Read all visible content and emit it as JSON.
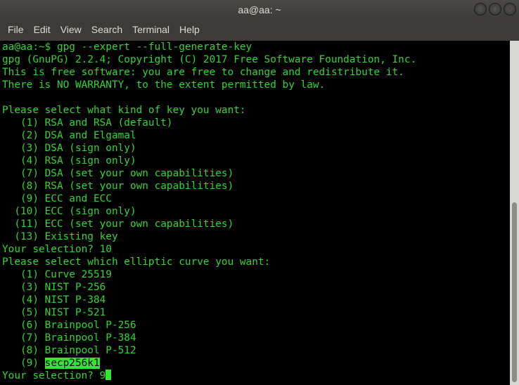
{
  "window": {
    "title": "aa@aa: ~"
  },
  "menu": [
    "File",
    "Edit",
    "View",
    "Search",
    "Terminal",
    "Help"
  ],
  "terminal": {
    "lines": [
      "aa@aa:~$ gpg --expert --full-generate-key",
      "gpg (GnuPG) 2.2.4; Copyright (C) 2017 Free Software Foundation, Inc.",
      "This is free software: you are free to change and redistribute it.",
      "There is NO WARRANTY, to the extent permitted by law.",
      "",
      "Please select what kind of key you want:",
      "   (1) RSA and RSA (default)",
      "   (2) DSA and Elgamal",
      "   (3) DSA (sign only)",
      "   (4) RSA (sign only)",
      "   (7) DSA (set your own capabilities)",
      "   (8) RSA (set your own capabilities)",
      "   (9) ECC and ECC",
      "  (10) ECC (sign only)",
      "  (11) ECC (set your own capabilities)",
      "  (13) Existing key",
      "Your selection? 10",
      "Please select which elliptic curve you want:",
      "   (1) Curve 25519",
      "   (3) NIST P-256",
      "   (4) NIST P-384",
      "   (5) NIST P-521",
      "   (6) Brainpool P-256",
      "   (7) Brainpool P-384",
      "   (8) Brainpool P-512"
    ],
    "selected_option_prefix": "   (9) ",
    "selected_option_label": "secp256k1",
    "prompt_line": "Your selection? 9"
  },
  "colors": {
    "terminal_fg": "#33d433",
    "terminal_bg": "#000000",
    "highlight": "#33e633"
  }
}
